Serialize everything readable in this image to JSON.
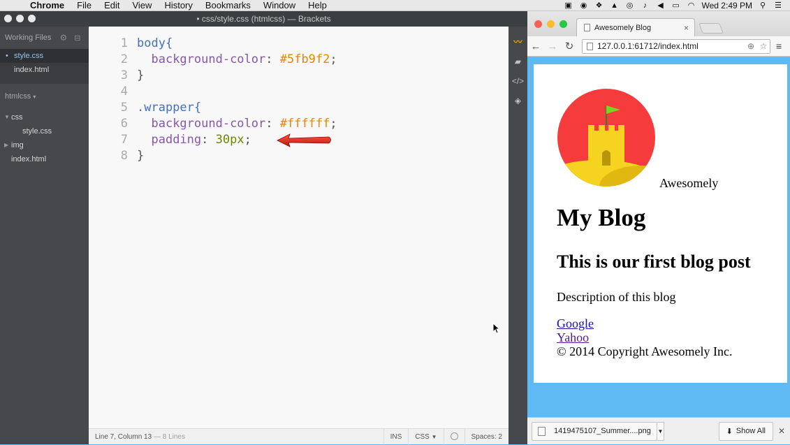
{
  "menubar": {
    "items": [
      "Chrome",
      "File",
      "Edit",
      "View",
      "History",
      "Bookmarks",
      "Window",
      "Help"
    ],
    "clock": "Wed 2:49 PM"
  },
  "brackets": {
    "title": "• css/style.css (htmlcss) — Brackets",
    "sidebar": {
      "working_files_label": "Working Files",
      "working_files": [
        {
          "name": "style.css",
          "active": true
        },
        {
          "name": "index.html",
          "active": false
        }
      ],
      "project_name": "htmlcss",
      "tree": {
        "css_folder": "css",
        "css_child": "style.css",
        "img_folder": "img",
        "index_file": "index.html"
      }
    },
    "code_lines": [
      "1",
      "2",
      "3",
      "4",
      "5",
      "6",
      "7",
      "8"
    ],
    "code": {
      "l1_selector": "body{",
      "l2_prop": "background-color",
      "l2_val": "#5fb9f2",
      "l3": "}",
      "l5_selector": ".wrapper{",
      "l6_prop": "background-color",
      "l6_val": "#ffffff",
      "l7_prop": "padding",
      "l7_val": "30px",
      "l8": "}"
    },
    "statusbar": {
      "position": "Line 7, Column 13",
      "lines": "— 8 Lines",
      "mode": "INS",
      "language": "CSS",
      "spaces": "Spaces: 2"
    }
  },
  "chrome": {
    "tab_title": "Awesomely Blog",
    "url": "127.0.0.1:61712/index.html",
    "page": {
      "logo_caption": "Awesomely",
      "heading": "My Blog",
      "post_title": "This is our first blog post",
      "description": "Description of this blog",
      "links": [
        "Google",
        "Yahoo"
      ],
      "copyright": "© 2014 Copyright Awesomely Inc."
    },
    "downloads": {
      "file": "1419475107_Summer....png",
      "show_all": "Show All"
    }
  },
  "colors": {
    "page_bg": "#5fb9f2",
    "logo_red": "#f53b3b",
    "logo_yellow": "#f5d320",
    "arrow_red": "#e8261b"
  }
}
